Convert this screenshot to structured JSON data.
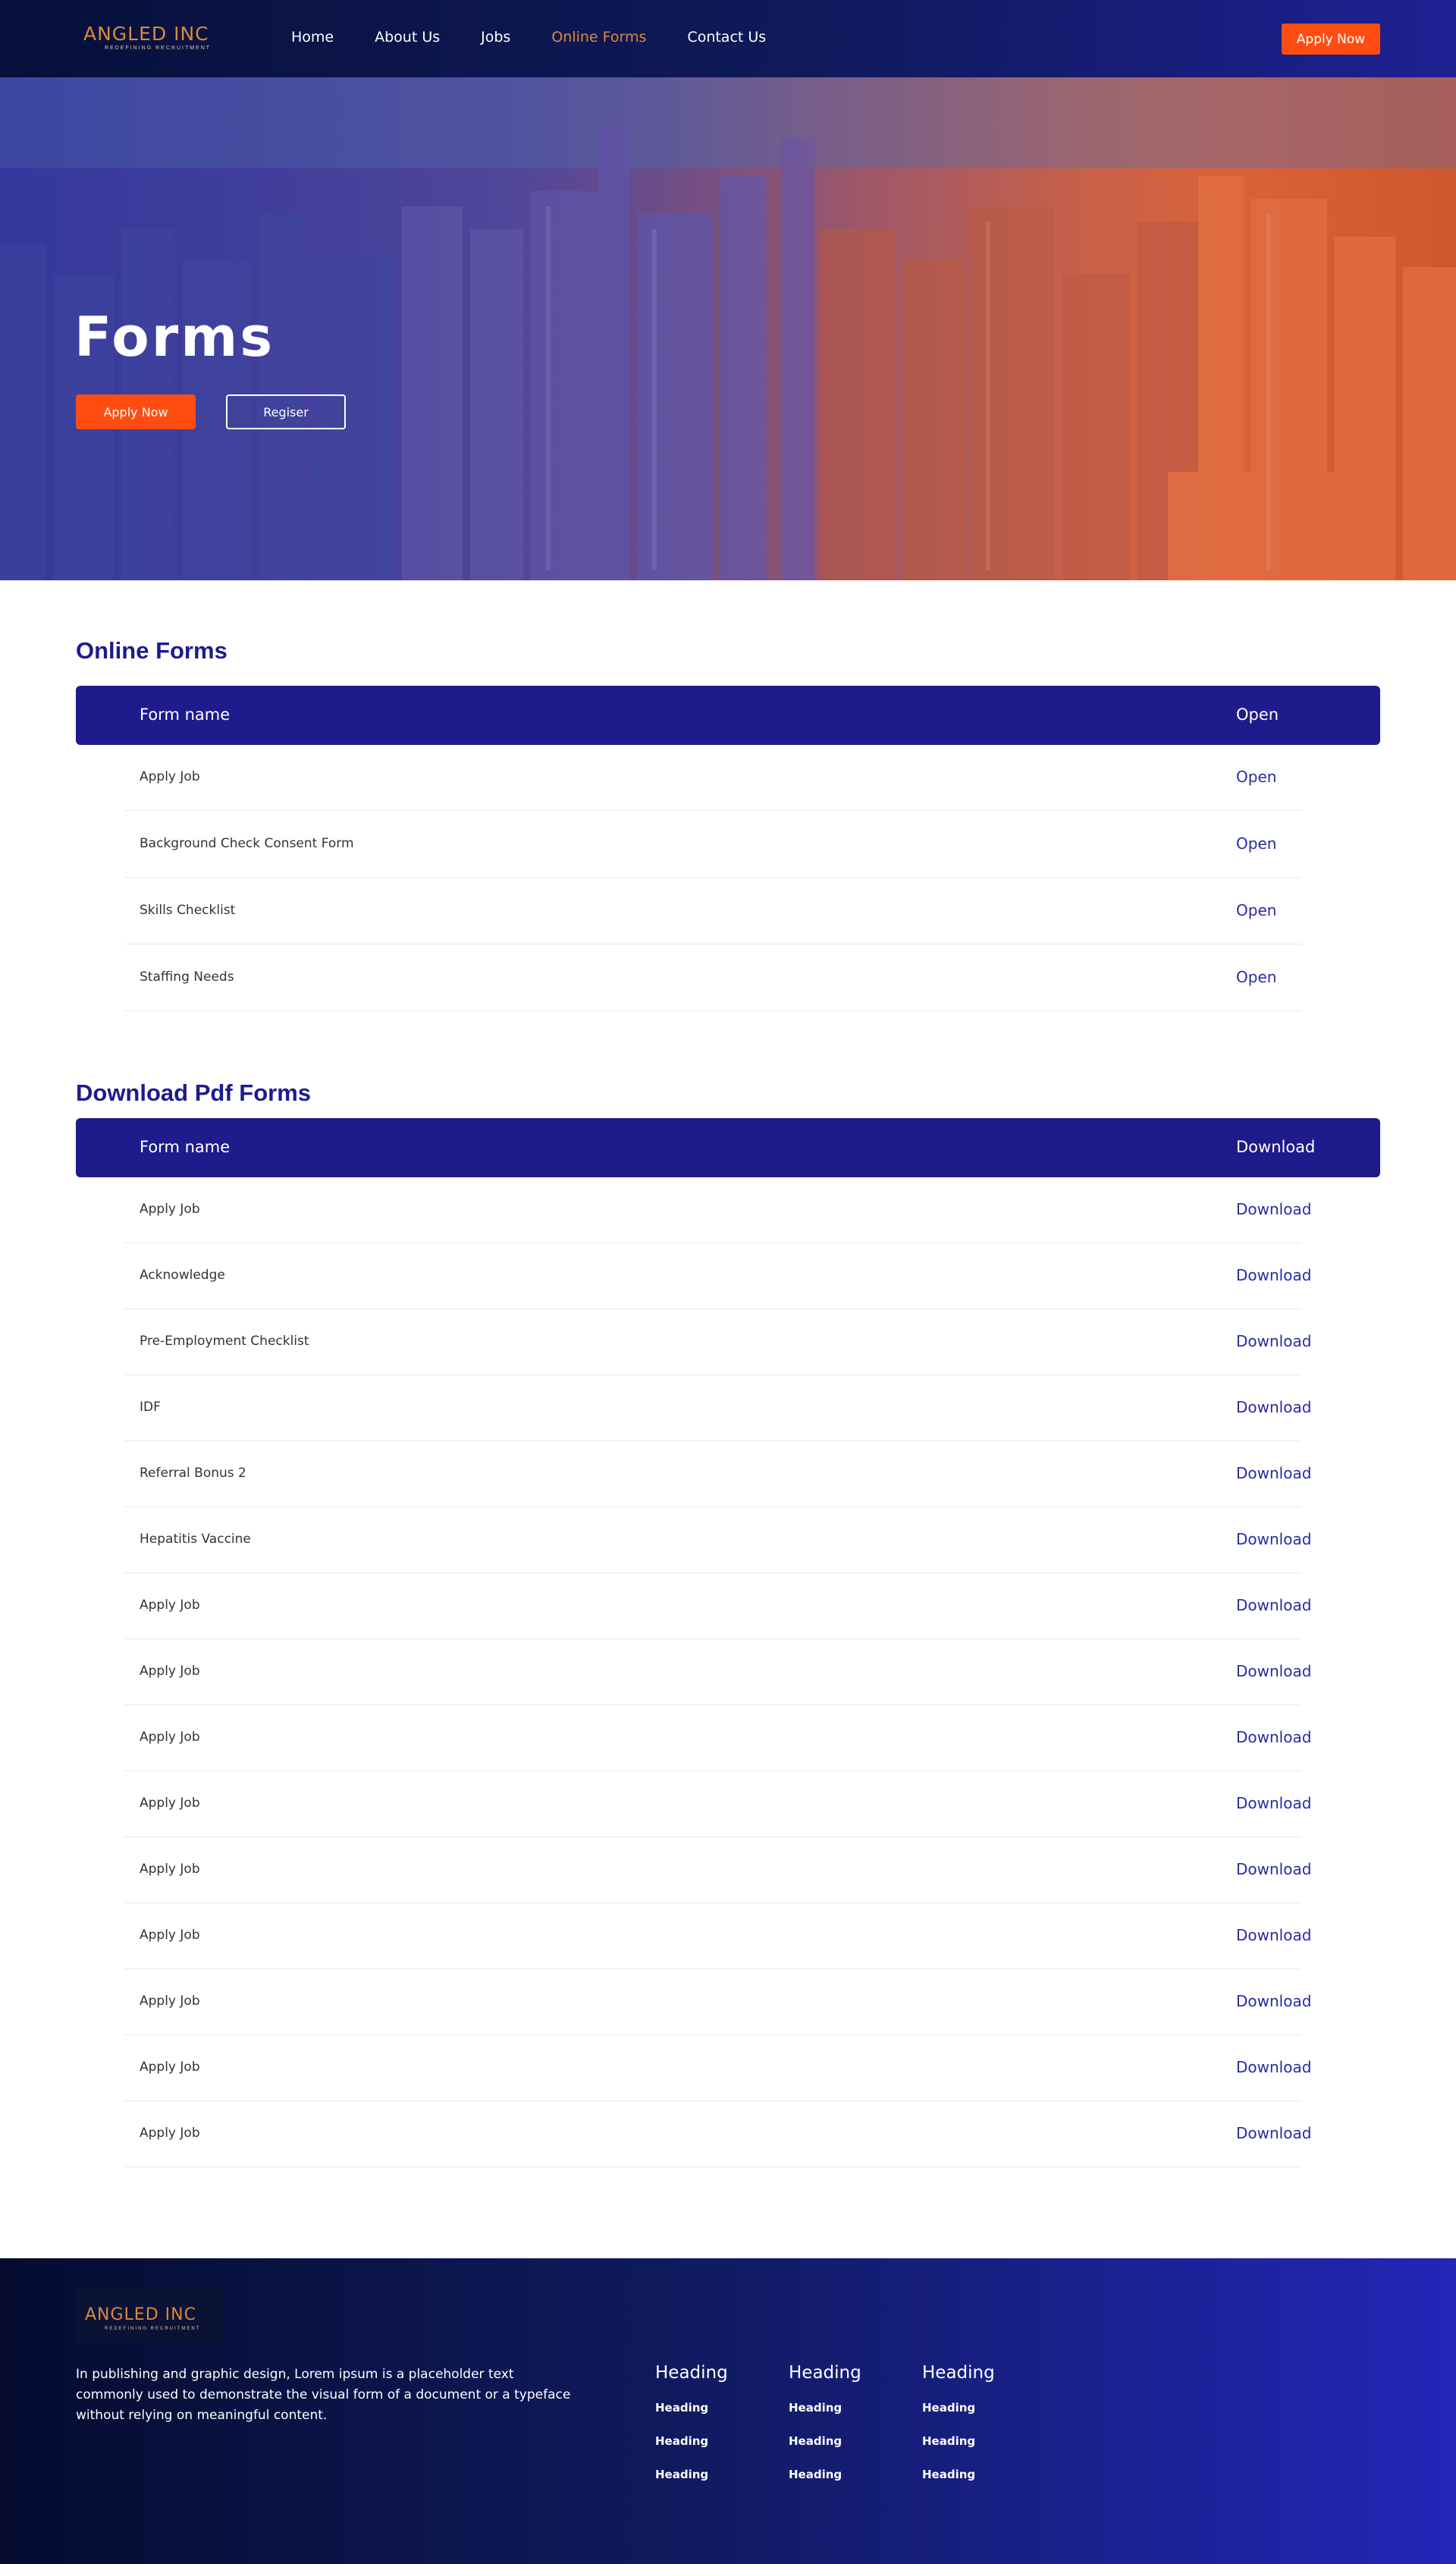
{
  "header": {
    "logo": {
      "brand": "ANGLED INC",
      "tagline": "REDEFINING RECRUITMENT"
    },
    "nav": [
      {
        "label": "Home",
        "active": false
      },
      {
        "label": "About Us",
        "active": false
      },
      {
        "label": "Jobs",
        "active": false
      },
      {
        "label": "Online Forms",
        "active": true
      },
      {
        "label": "Contact Us",
        "active": false
      }
    ],
    "cta_label": "Apply Now"
  },
  "hero": {
    "title": "Forms",
    "apply_label": "Apply Now",
    "register_label": "Regiser"
  },
  "online_forms": {
    "title": "Online Forms",
    "col_name": "Form name",
    "col_action": "Open",
    "rows": [
      {
        "name": "Apply Job",
        "action": "Open"
      },
      {
        "name": "Background Check Consent Form",
        "action": "Open"
      },
      {
        "name": "Skills Checklist",
        "action": "Open"
      },
      {
        "name": "Staffing Needs",
        "action": "Open"
      }
    ]
  },
  "pdf_forms": {
    "title": "Download Pdf Forms",
    "col_name": "Form name",
    "col_action": "Download",
    "rows": [
      {
        "name": "Apply Job",
        "action": "Download"
      },
      {
        "name": "Acknowledge",
        "action": "Download"
      },
      {
        "name": "Pre-Employment Checklist",
        "action": "Download"
      },
      {
        "name": "IDF",
        "action": "Download"
      },
      {
        "name": "Referral Bonus 2",
        "action": "Download"
      },
      {
        "name": "Hepatitis Vaccine",
        "action": "Download"
      },
      {
        "name": "Apply Job",
        "action": "Download"
      },
      {
        "name": "Apply Job",
        "action": "Download"
      },
      {
        "name": "Apply Job",
        "action": "Download"
      },
      {
        "name": "Apply Job",
        "action": "Download"
      },
      {
        "name": "Apply Job",
        "action": "Download"
      },
      {
        "name": "Apply Job",
        "action": "Download"
      },
      {
        "name": "Apply Job",
        "action": "Download"
      },
      {
        "name": "Apply Job",
        "action": "Download"
      },
      {
        "name": "Apply Job",
        "action": "Download"
      }
    ]
  },
  "footer": {
    "logo": {
      "brand": "ANGLED INC",
      "tagline": "REDEFINING RECRUITMENT"
    },
    "text": "In publishing and graphic design, Lorem ipsum is a placeholder text commonly used to demonstrate the visual form of a document or a typeface without relying on meaningful content.",
    "columns": [
      {
        "heading": "Heading",
        "links": [
          "Heading",
          "Heading",
          "Heading"
        ]
      },
      {
        "heading": "Heading",
        "links": [
          "Heading",
          "Heading",
          "Heading"
        ]
      },
      {
        "heading": "Heading",
        "links": [
          "Heading",
          "Heading",
          "Heading"
        ]
      }
    ]
  },
  "colors": {
    "accent": "#ff4d12",
    "navy": "#1e1b8d",
    "link": "#2a2aa8",
    "active_nav": "#d9893d"
  }
}
